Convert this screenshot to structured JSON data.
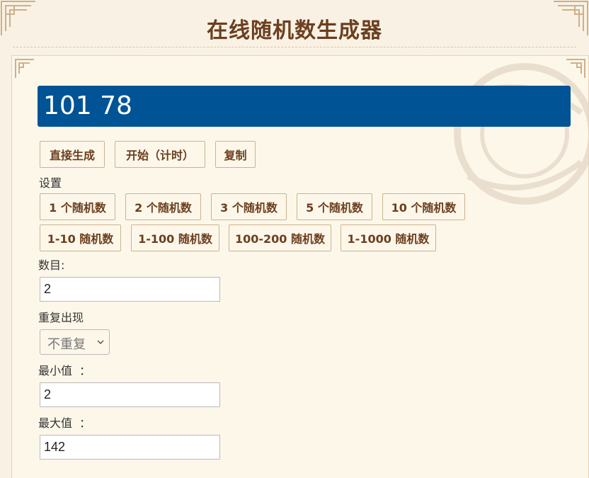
{
  "header": {
    "title": "在线随机数生成器"
  },
  "result": {
    "value": "101 78"
  },
  "actions": {
    "generate_label": "直接生成",
    "start_label": "开始（计时）",
    "copy_label": "复制"
  },
  "settings": {
    "label": "设置",
    "count_presets": [
      "1 个随机数",
      "2 个随机数",
      "3 个随机数",
      "5 个随机数",
      "10 个随机数"
    ],
    "range_presets": [
      "1-10 随机数",
      "1-100 随机数",
      "100-200 随机数",
      "1-1000 随机数"
    ]
  },
  "form": {
    "count": {
      "label": "数目:",
      "value": "2"
    },
    "repeat": {
      "label": "重复出现",
      "selected": "不重复"
    },
    "min": {
      "label": "最小值  ：",
      "value": "2"
    },
    "max": {
      "label": "最大值  ：",
      "value": "142"
    }
  },
  "colors": {
    "result_bg": "#005395",
    "button_text": "#6b3f1f",
    "page_bg": "#f9f2e4"
  }
}
